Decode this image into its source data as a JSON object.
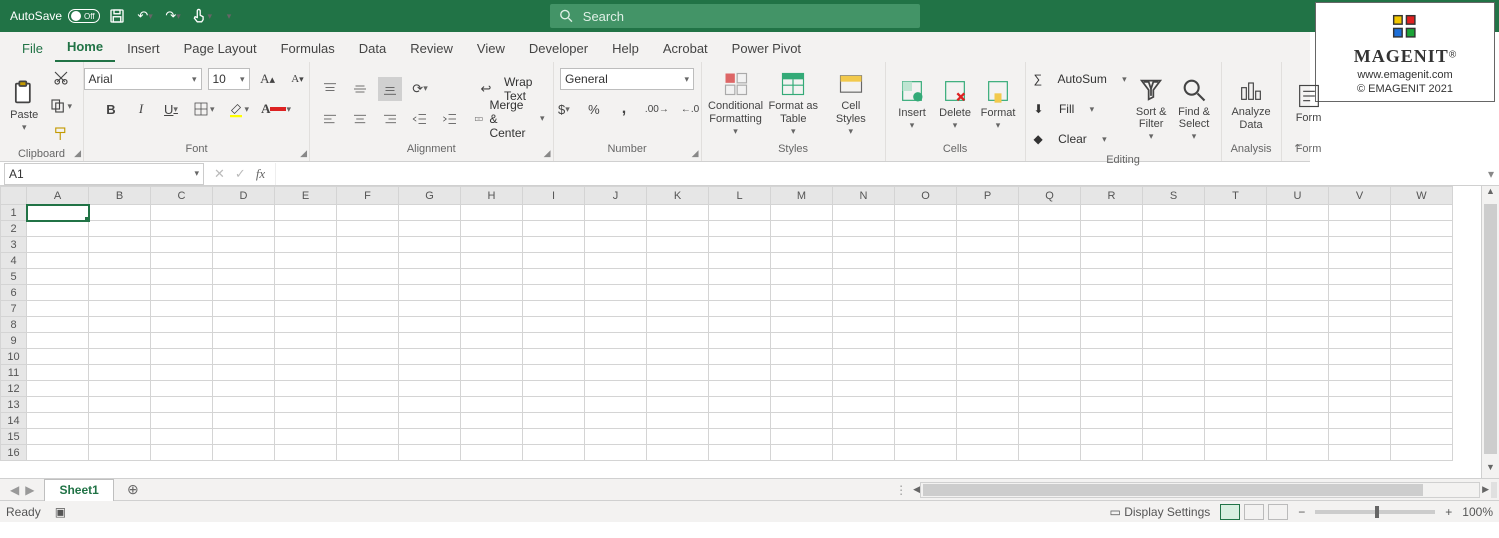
{
  "titlebar": {
    "autosave_label": "AutoSave",
    "autosave_state": "Off",
    "search_placeholder": "Search"
  },
  "brand": {
    "name": "MAGENIT",
    "url": "www.emagenit.com",
    "copyright": "© EMAGENIT  2021"
  },
  "tabs": [
    "File",
    "Home",
    "Insert",
    "Page Layout",
    "Formulas",
    "Data",
    "Review",
    "View",
    "Developer",
    "Help",
    "Acrobat",
    "Power Pivot"
  ],
  "active_tab": "Home",
  "ribbon": {
    "clipboard": {
      "paste": "Paste",
      "label": "Clipboard"
    },
    "font": {
      "name": "Arial",
      "size": "10",
      "label": "Font"
    },
    "alignment": {
      "wrap": "Wrap Text",
      "merge": "Merge & Center",
      "label": "Alignment"
    },
    "number": {
      "format": "General",
      "label": "Number"
    },
    "styles": {
      "cond": "Conditional Formatting",
      "table": "Format as Table",
      "cell": "Cell Styles",
      "label": "Styles"
    },
    "cells": {
      "insert": "Insert",
      "delete": "Delete",
      "format": "Format",
      "label": "Cells"
    },
    "editing": {
      "autosum": "AutoSum",
      "fill": "Fill",
      "clear": "Clear",
      "sort": "Sort & Filter",
      "find": "Find & Select",
      "label": "Editing"
    },
    "analysis": {
      "analyze": "Analyze Data",
      "label": "Analysis"
    },
    "form": {
      "form": "Form",
      "label": "Form"
    }
  },
  "namebox": {
    "value": "A1"
  },
  "columns": [
    "A",
    "B",
    "C",
    "D",
    "E",
    "F",
    "G",
    "H",
    "I",
    "J",
    "K",
    "L",
    "M",
    "N",
    "O",
    "P",
    "Q",
    "R",
    "S",
    "T",
    "U",
    "V",
    "W"
  ],
  "rows": [
    1,
    2,
    3,
    4,
    5,
    6,
    7,
    8,
    9,
    10,
    11,
    12,
    13,
    14,
    15,
    16
  ],
  "selected_cell": "A1",
  "sheet_tabs": {
    "active": "Sheet1"
  },
  "status": {
    "ready": "Ready",
    "display": "Display Settings",
    "zoom": "100%"
  }
}
